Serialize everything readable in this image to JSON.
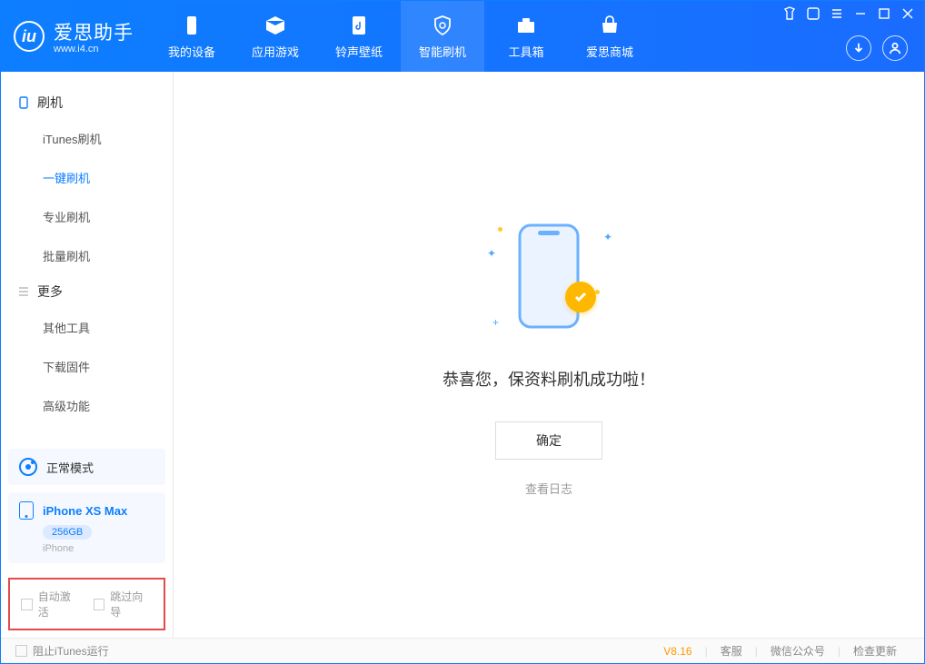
{
  "logo": {
    "icon_letter": "iu",
    "title_cn": "爱思助手",
    "title_en": "www.i4.cn"
  },
  "nav": [
    {
      "label": "我的设备"
    },
    {
      "label": "应用游戏"
    },
    {
      "label": "铃声壁纸"
    },
    {
      "label": "智能刷机"
    },
    {
      "label": "工具箱"
    },
    {
      "label": "爱思商城"
    }
  ],
  "sidebar": {
    "group1": {
      "title": "刷机",
      "items": [
        "iTunes刷机",
        "一键刷机",
        "专业刷机",
        "批量刷机"
      ]
    },
    "group2": {
      "title": "更多",
      "items": [
        "其他工具",
        "下载固件",
        "高级功能"
      ]
    }
  },
  "mode": {
    "label": "正常模式"
  },
  "device": {
    "name": "iPhone XS Max",
    "storage": "256GB",
    "type": "iPhone"
  },
  "options": {
    "auto_activate": "自动激活",
    "skip_guide": "跳过向导"
  },
  "main": {
    "success_title": "恭喜您，保资料刷机成功啦！",
    "ok_button": "确定",
    "view_log": "查看日志"
  },
  "footer": {
    "block_itunes": "阻止iTunes运行",
    "version": "V8.16",
    "support": "客服",
    "wechat": "微信公众号",
    "check_update": "检查更新"
  }
}
